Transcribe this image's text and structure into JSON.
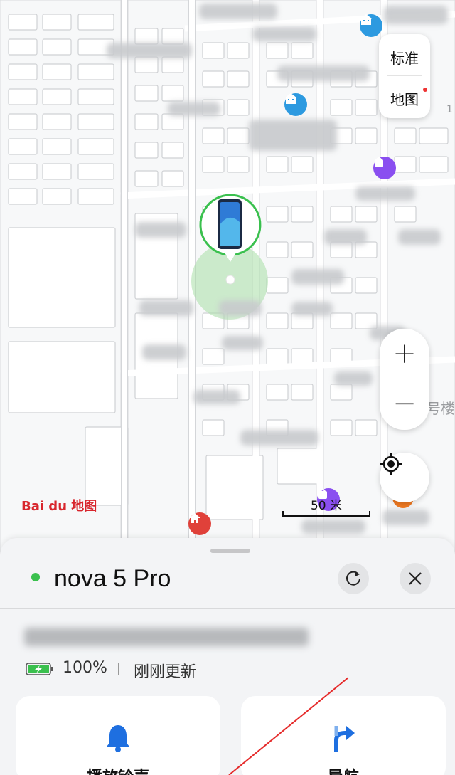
{
  "map": {
    "layer_options": [
      "标准",
      "地图"
    ],
    "zoom_in_label": "+",
    "zoom_out_label": "−",
    "road_label": "号楼",
    "provider_logo": "Bai du 地图",
    "scale_label": "50 米"
  },
  "device": {
    "name": "nova 5 Pro",
    "online": true,
    "battery_percent": "100%",
    "updated_text": "刚刚更新"
  },
  "actions": [
    {
      "label": "播放铃声",
      "icon": "bell-icon"
    },
    {
      "label": "导航",
      "icon": "navigation-arrow-icon"
    }
  ],
  "colors": {
    "accent_blue": "#1e6fe0",
    "online_green": "#3ac04e",
    "baidu_red": "#d8262d",
    "poi_purple": "#8a4ff0",
    "poi_blue": "#2d9ae0"
  }
}
